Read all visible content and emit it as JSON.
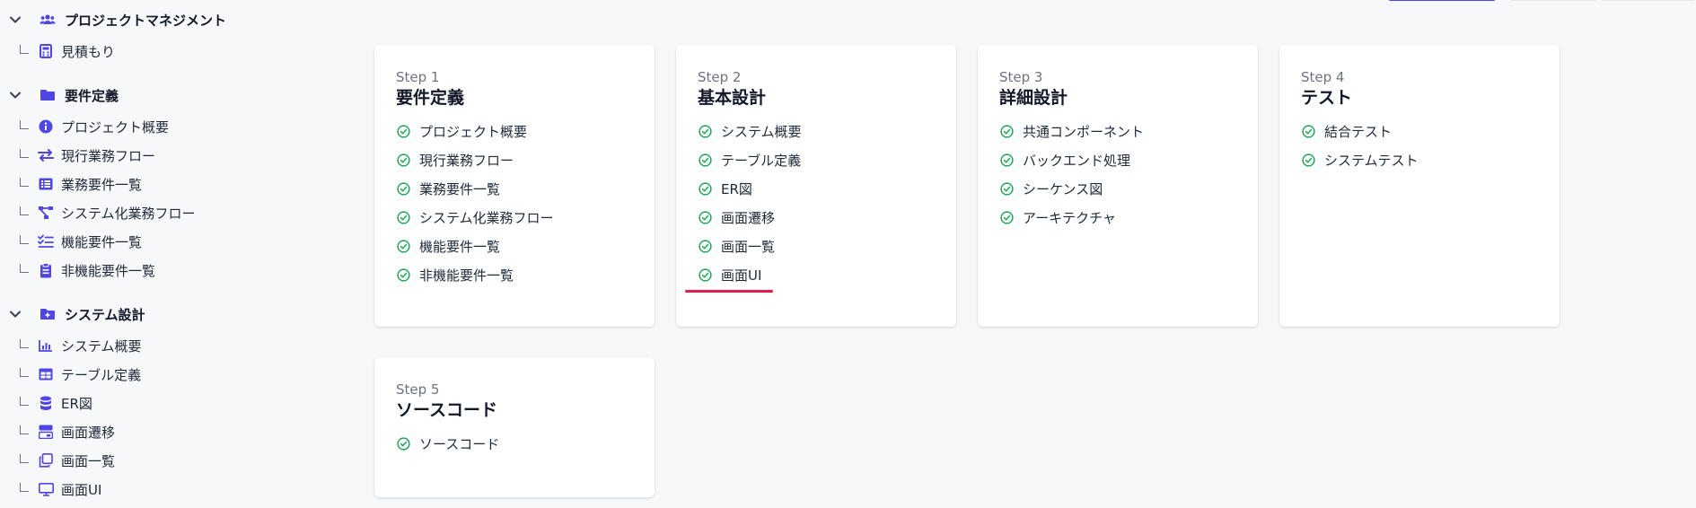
{
  "sidebar": {
    "sections": [
      {
        "label": "プロジェクトマネジメント",
        "icon": "users-icon",
        "items": [
          {
            "label": "見積もり",
            "icon": "calculator-icon"
          }
        ]
      },
      {
        "label": "要件定義",
        "icon": "folder-icon",
        "items": [
          {
            "label": "プロジェクト概要",
            "icon": "info-icon"
          },
          {
            "label": "現行業務フロー",
            "icon": "arrows-exchange-icon"
          },
          {
            "label": "業務要件一覧",
            "icon": "list-icon"
          },
          {
            "label": "システム化業務フロー",
            "icon": "flow-icon"
          },
          {
            "label": "機能要件一覧",
            "icon": "checklist-icon"
          },
          {
            "label": "非機能要件一覧",
            "icon": "clipboard-icon"
          }
        ]
      },
      {
        "label": "システム設計",
        "icon": "folder-plus-icon",
        "items": [
          {
            "label": "システム概要",
            "icon": "bar-chart-icon"
          },
          {
            "label": "テーブル定義",
            "icon": "table-icon"
          },
          {
            "label": "ER図",
            "icon": "database-icon"
          },
          {
            "label": "画面遷移",
            "icon": "transition-icon"
          },
          {
            "label": "画面一覧",
            "icon": "copy-icon"
          },
          {
            "label": "画面UI",
            "icon": "monitor-icon"
          }
        ]
      }
    ]
  },
  "cards": [
    {
      "step": "Step 1",
      "title": "要件定義",
      "tasks": [
        "プロジェクト概要",
        "現行業務フロー",
        "業務要件一覧",
        "システム化業務フロー",
        "機能要件一覧",
        "非機能要件一覧"
      ]
    },
    {
      "step": "Step 2",
      "title": "基本設計",
      "tasks": [
        "システム概要",
        "テーブル定義",
        "ER図",
        "画面遷移",
        "画面一覧",
        "画面UI"
      ]
    },
    {
      "step": "Step 3",
      "title": "詳細設計",
      "tasks": [
        "共通コンポーネント",
        "バックエンド処理",
        "シーケンス図",
        "アーキテクチャ"
      ]
    },
    {
      "step": "Step 4",
      "title": "テスト",
      "tasks": [
        "結合テスト",
        "システムテスト"
      ]
    },
    {
      "step": "Step 5",
      "title": "ソースコード",
      "tasks": [
        "ソースコード"
      ]
    }
  ],
  "colors": {
    "accent": "#4f46e5",
    "check": "#22a35a",
    "highlight_underline": "#e11d48"
  }
}
